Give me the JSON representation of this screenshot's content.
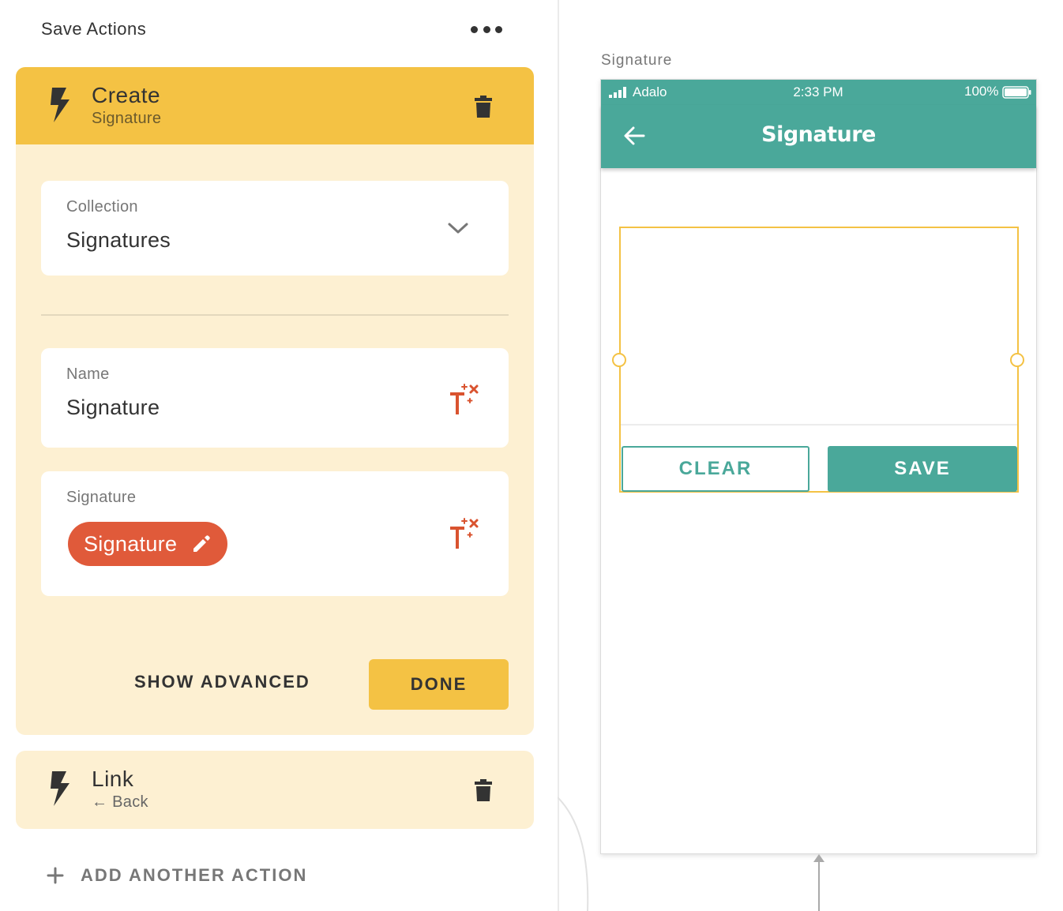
{
  "panel": {
    "title": "Save Actions",
    "more_icon": "more-horizontal-icon"
  },
  "actions": [
    {
      "title": "Create",
      "subtitle": "Signature",
      "icon": "lightning-bolt-icon",
      "expanded": true,
      "fields": {
        "collection": {
          "label": "Collection",
          "value": "Signatures"
        },
        "name": {
          "label": "Name",
          "value": "Signature"
        },
        "signature": {
          "label": "Signature",
          "chip": "Signature"
        }
      },
      "show_advanced_label": "SHOW ADVANCED",
      "done_label": "DONE"
    },
    {
      "title": "Link",
      "subtitle": "← Back",
      "icon": "lightning-bolt-icon",
      "expanded": false
    }
  ],
  "add_action_label": "ADD ANOTHER ACTION",
  "screen": {
    "label": "Signature",
    "status": {
      "carrier": "Adalo",
      "time": "2:33 PM",
      "battery": "100%"
    },
    "title": "Signature",
    "clear_label": "CLEAR",
    "save_label": "SAVE"
  },
  "colors": {
    "accent_yellow": "#f4c244",
    "card_bg": "#fdf0d2",
    "chip_red": "#e05a3a",
    "magic_red": "#d9532f",
    "teal": "#4aa89a"
  }
}
